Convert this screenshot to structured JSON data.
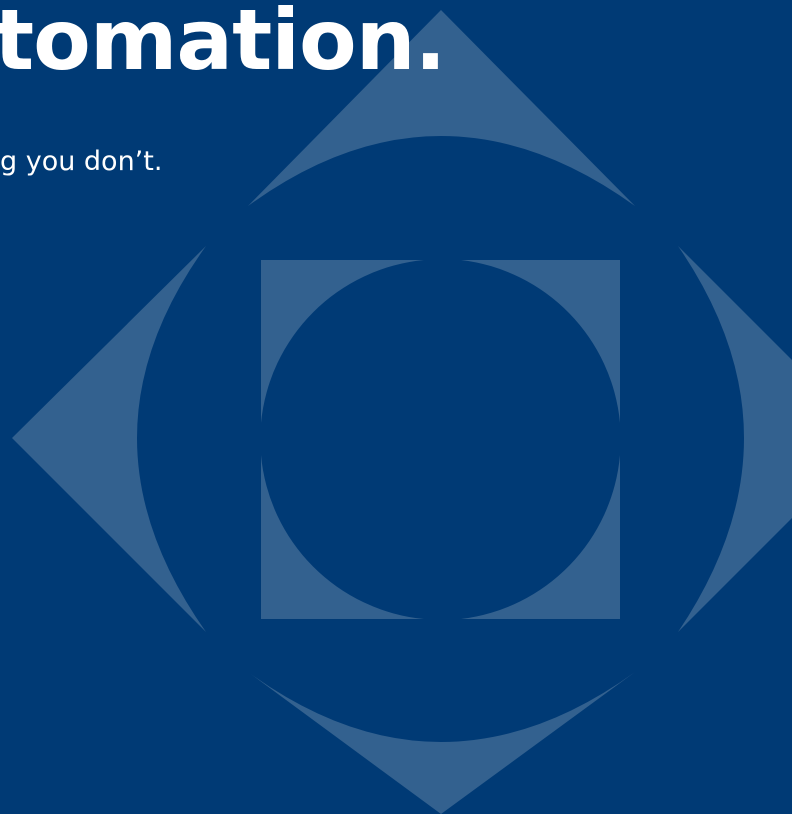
{
  "hero": {
    "headline": "tomation.",
    "subheadline": "g you don’t."
  },
  "emblem": {
    "icon": "geometric-diamond-circle-emblem"
  },
  "colors": {
    "background": "#003a75",
    "shape_fill": "#33618f",
    "text": "#ffffff"
  }
}
